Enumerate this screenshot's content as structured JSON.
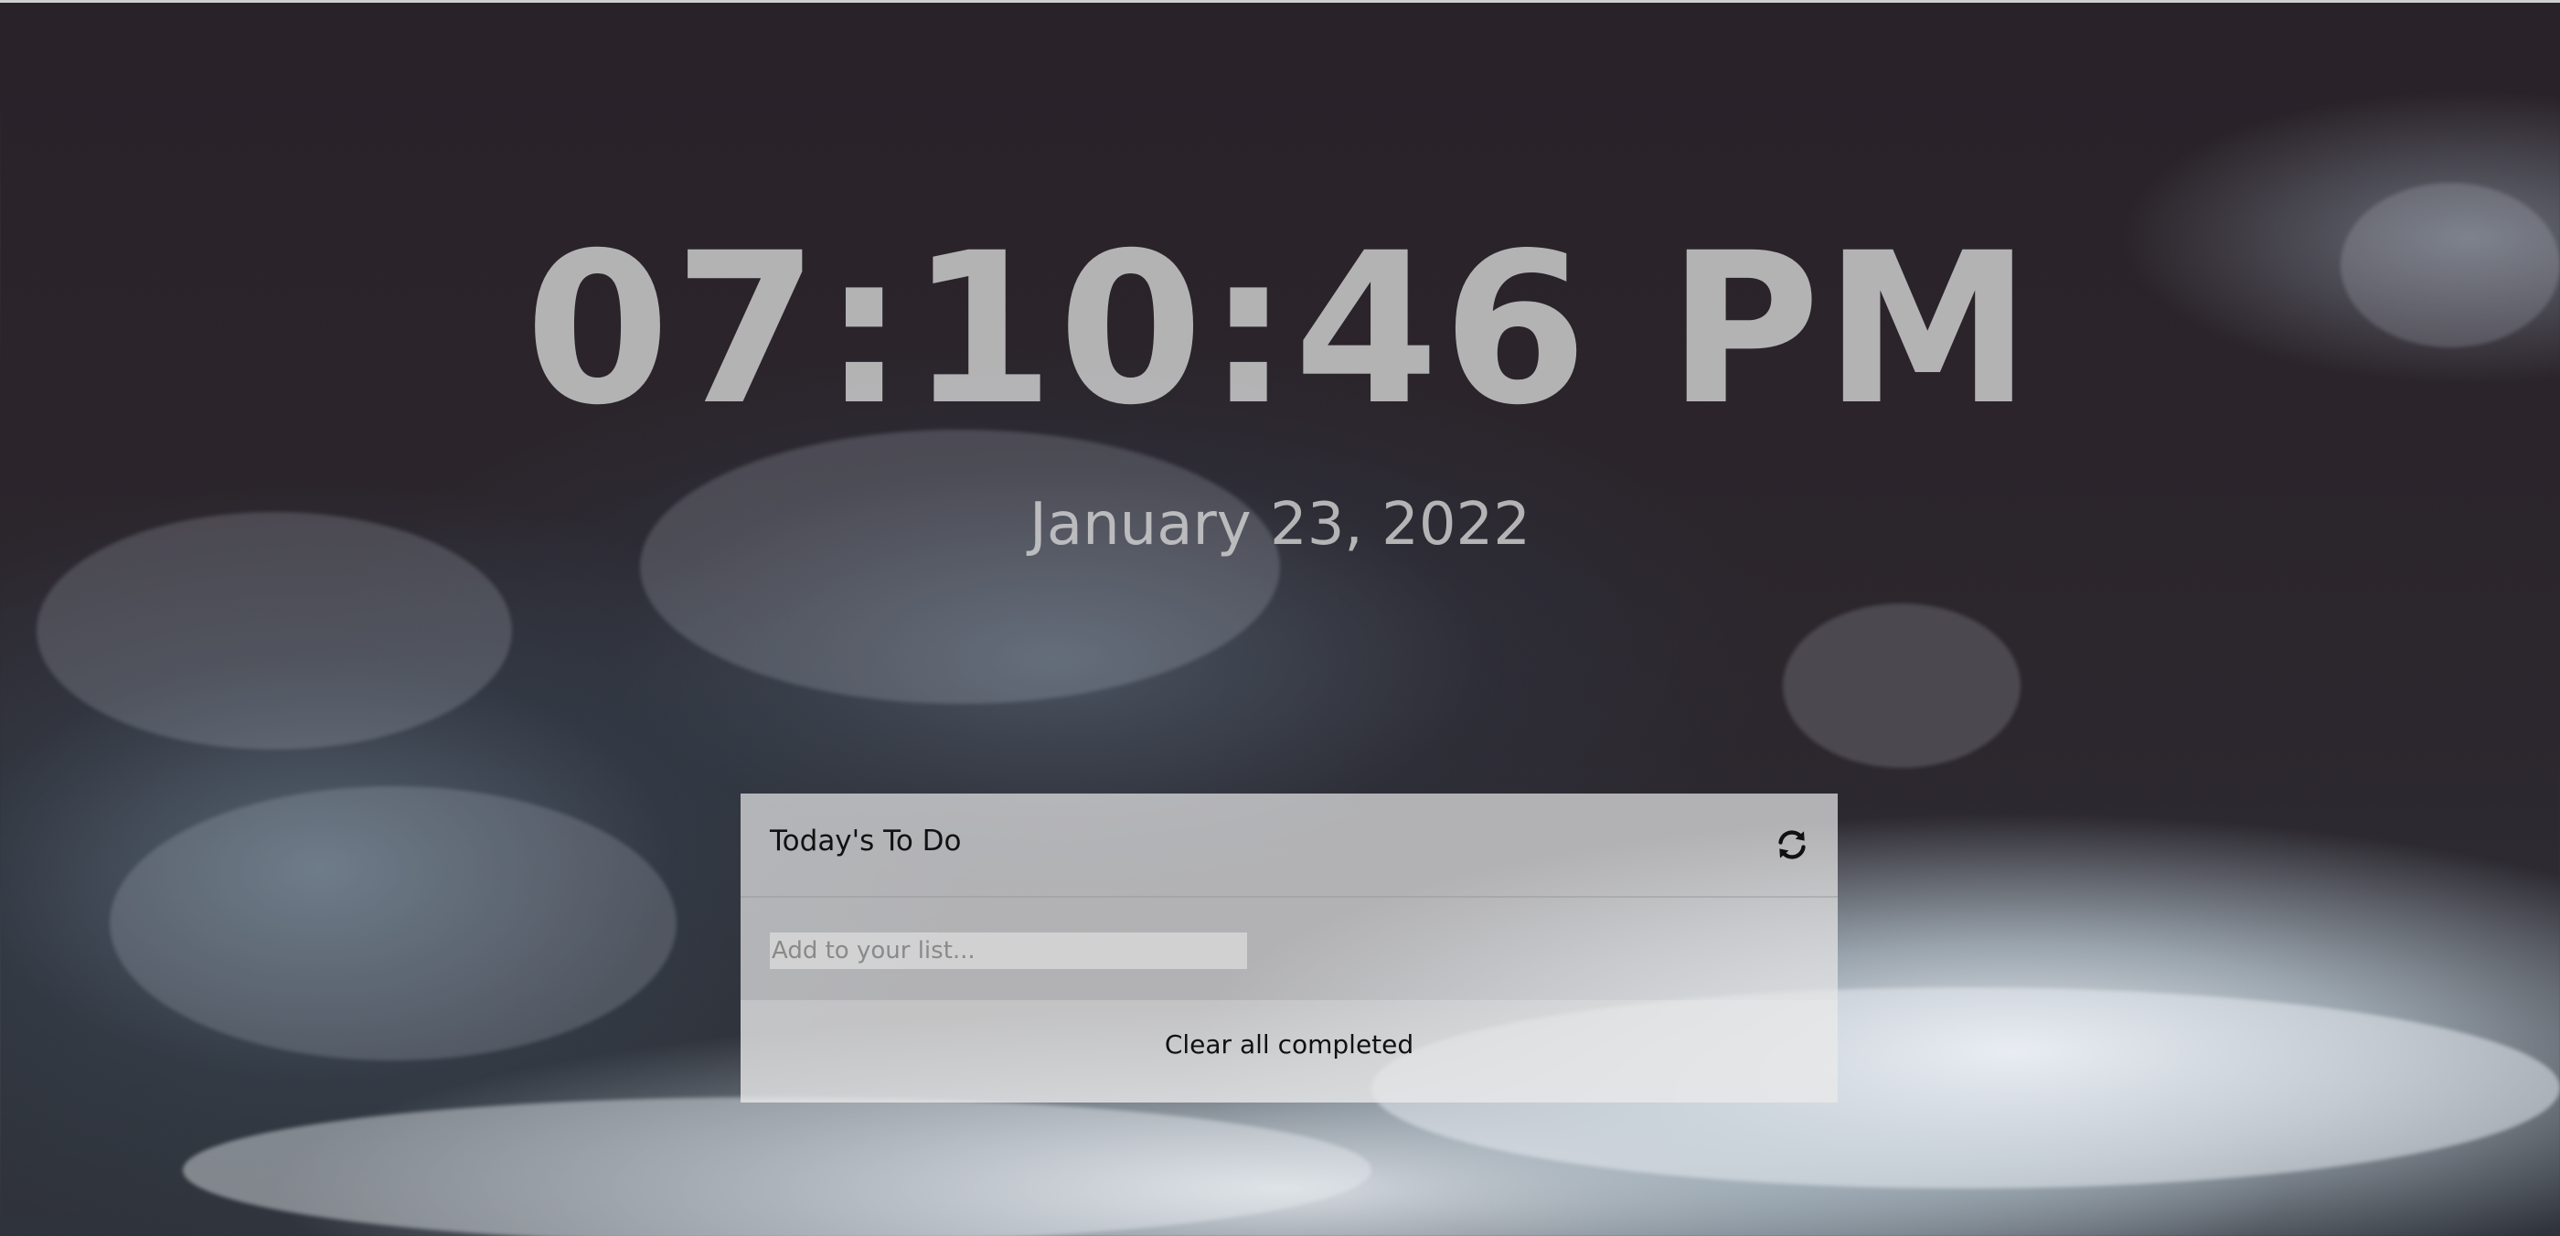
{
  "clock": {
    "time": "07:10:46 PM"
  },
  "date": {
    "text": "January 23, 2022"
  },
  "todo": {
    "title": "Today's To Do",
    "refresh_icon": "refresh-icon",
    "input_placeholder": "Add to your list...",
    "input_value": "",
    "clear_label": "Clear all completed"
  },
  "background": {
    "description_icon": "ocean-waves-background"
  }
}
